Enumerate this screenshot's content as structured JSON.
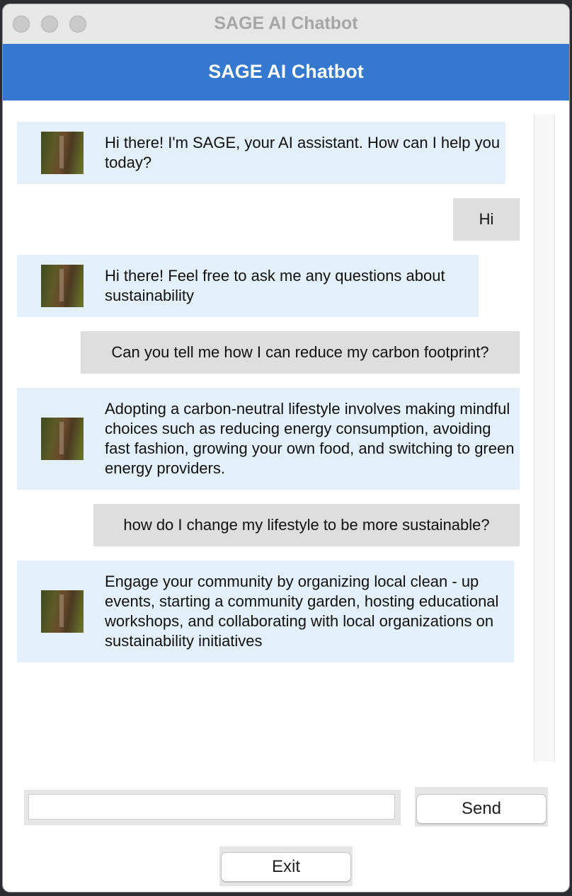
{
  "window": {
    "title": "SAGE AI Chatbot"
  },
  "header": {
    "title": "SAGE AI Chatbot"
  },
  "messages": [
    {
      "sender": "bot",
      "text": "Hi there! I'm SAGE, your AI assistant. How can I help you today?"
    },
    {
      "sender": "user",
      "text": "Hi"
    },
    {
      "sender": "bot",
      "text": "Hi there! Feel free to ask me any questions about sustainability"
    },
    {
      "sender": "user",
      "text": "Can you tell me how I can reduce my carbon footprint?"
    },
    {
      "sender": "bot",
      "text": "Adopting a carbon-neutral lifestyle involves making mindful choices such as reducing energy consumption, avoiding fast fashion, growing your own food, and switching to green energy providers."
    },
    {
      "sender": "user",
      "text": "how do I change my lifestyle to be more sustainable?"
    },
    {
      "sender": "bot",
      "text": "Engage your community by organizing local clean - up events, starting a community garden, hosting educational workshops, and collaborating with local organizations on sustainability initiatives"
    }
  ],
  "input": {
    "value": "",
    "placeholder": ""
  },
  "buttons": {
    "send_label": "Send",
    "exit_label": "Exit"
  },
  "colors": {
    "header_bg": "#3478d0",
    "bot_bubble": "#e3eff9",
    "user_bubble": "#dedede"
  },
  "icons": {
    "bot_avatar": "bot-avatar-image"
  }
}
